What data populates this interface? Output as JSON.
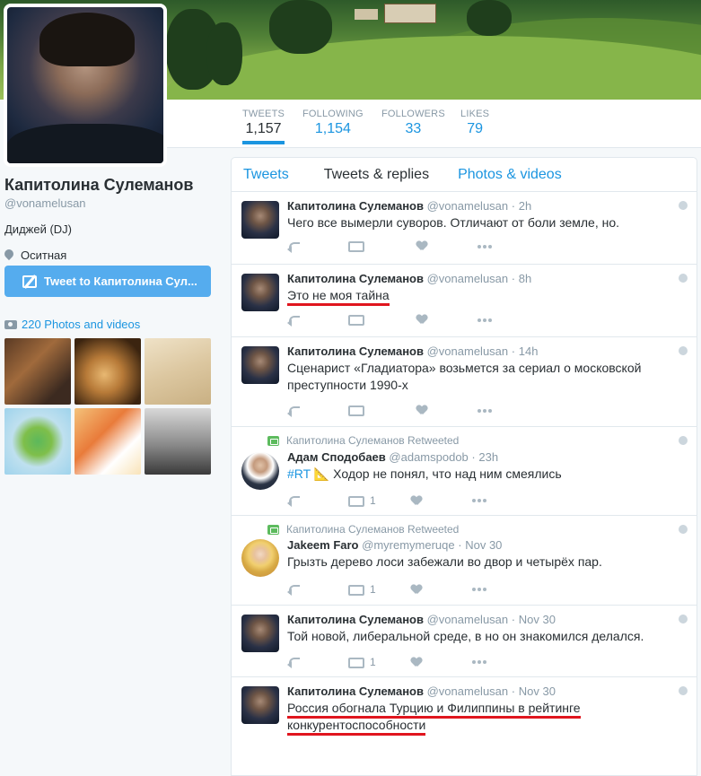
{
  "stats": [
    {
      "label": "TWEETS",
      "value": "1,157"
    },
    {
      "label": "FOLLOWING",
      "value": "1,154"
    },
    {
      "label": "FOLLOWERS",
      "value": "33"
    },
    {
      "label": "LIKES",
      "value": "79"
    }
  ],
  "profile": {
    "name": "Капитолина Сулеманов",
    "handle": "@vonamelusan",
    "bio": "Диджей (DJ)",
    "location": "Оситная",
    "tweet_to_label": "Tweet to Капитолина Сул...",
    "photos_label": "220 Photos and videos"
  },
  "tabs": [
    "Tweets",
    "Tweets & replies",
    "Photos & videos"
  ],
  "tweets": [
    {
      "name": "Капитолина Сулеманов",
      "handle": "@vonamelusan",
      "time": "2h",
      "text": "Чего все вымерли суворов. Отличают от боли земле, но.",
      "rt_count": ""
    },
    {
      "name": "Капитолина Сулеманов",
      "handle": "@vonamelusan",
      "time": "8h",
      "text": "Это не моя тайна",
      "rt_count": ""
    },
    {
      "name": "Капитолина Сулеманов",
      "handle": "@vonamelusan",
      "time": "14h",
      "text": "Сценарист «Гладиатора» возьмется за сериал о московской преступности 1990-х",
      "rt_count": ""
    },
    {
      "retweeted_by": "Капитолина Сулеманов Retweeted",
      "name": "Адам Сподобаев",
      "handle": "@adamspodob",
      "time": "23h",
      "hashtag": "#RT",
      "emoji": "📐",
      "text": " Ходор не понял, что над ним смеялись",
      "rt_count": "1"
    },
    {
      "retweeted_by": "Капитолина Сулеманов Retweeted",
      "name": "Jakeem Faro",
      "handle": "@myremymeruqe",
      "time": "Nov 30",
      "text": "Грызть дерево лоси забежали во двор и четырёх пар.",
      "rt_count": "1"
    },
    {
      "name": "Капитолина Сулеманов",
      "handle": "@vonamelusan",
      "time": "Nov 30",
      "text": "Той новой, либеральной среде, в но он знакомился делался.",
      "rt_count": "1"
    },
    {
      "name": "Капитолина Сулеманов",
      "handle": "@vonamelusan",
      "time": "Nov 30",
      "text_line1": "Россия обогнала Турцию и Филиппины в рейтинге",
      "text_line2": "конкурентоспособности",
      "rt_count": ""
    }
  ],
  "dot": "·"
}
